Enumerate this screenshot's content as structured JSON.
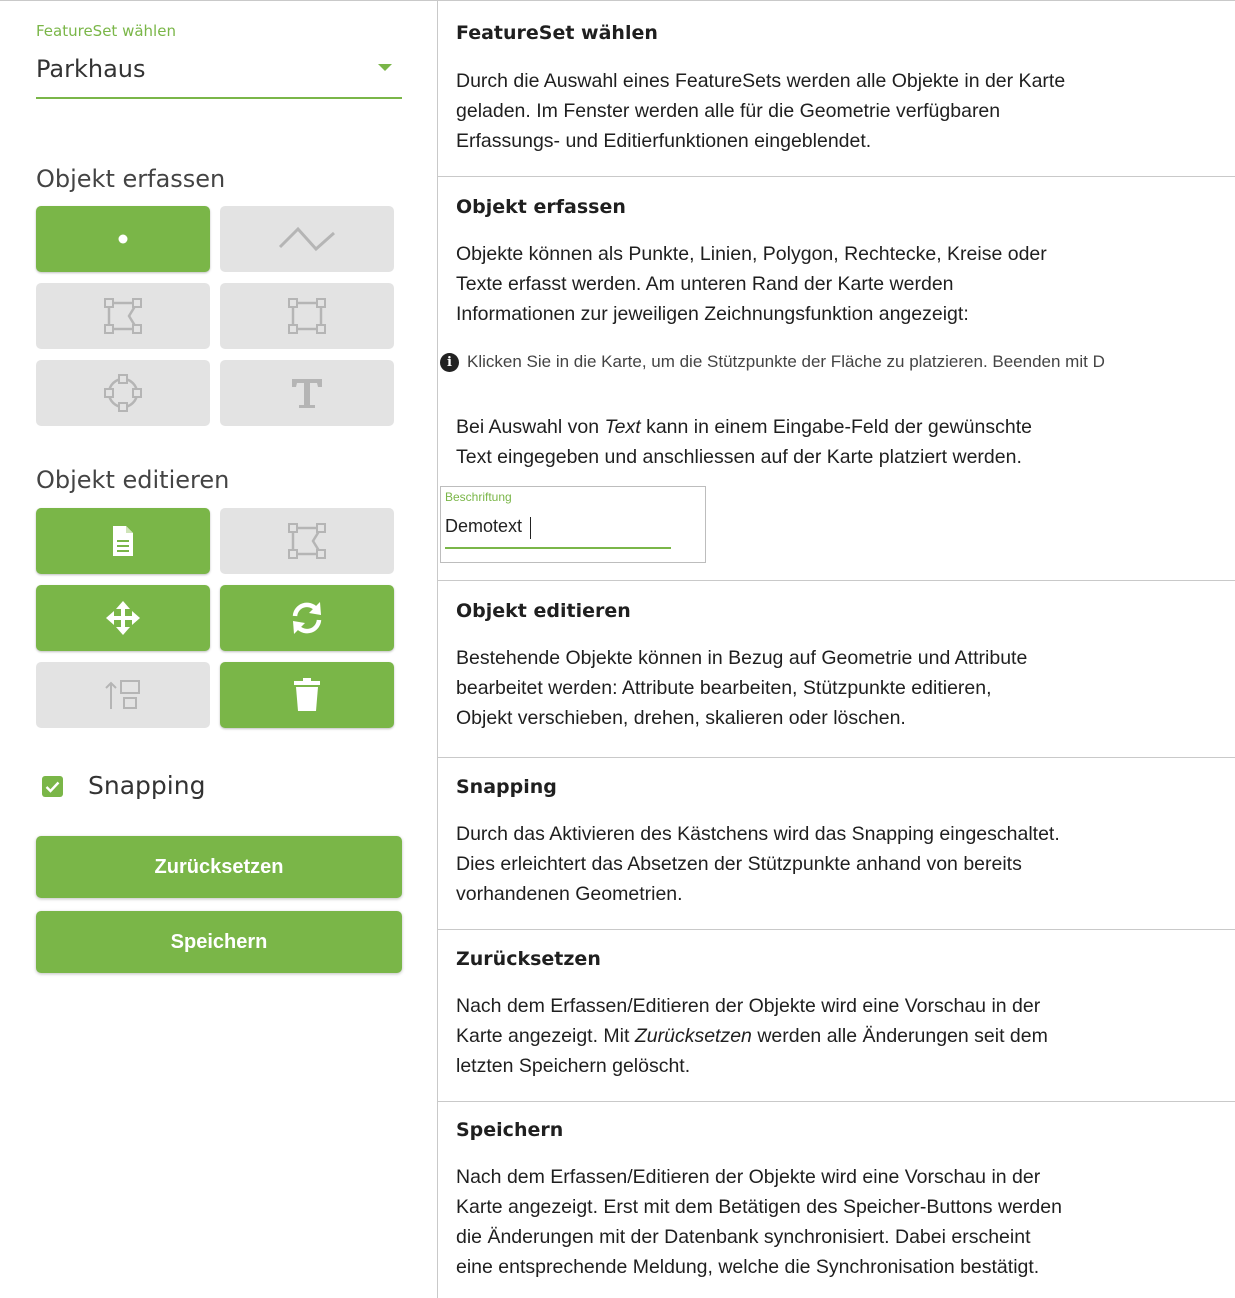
{
  "widget": {
    "featureset_label": "FeatureSet wählen",
    "featureset_value": "Parkhaus",
    "create_title": "Objekt erfassen",
    "edit_title": "Objekt editieren",
    "snapping_label": "Snapping",
    "reset_label": "Zurücksetzen",
    "save_label": "Speichern",
    "colors": {
      "accent": "#7ab648",
      "inactive": "#e3e3e3",
      "inactive_icon": "#b5b5b5"
    },
    "create_tools": [
      {
        "icon": "point-icon",
        "active": true
      },
      {
        "icon": "polyline-icon",
        "active": false
      },
      {
        "icon": "polygon-icon",
        "active": false
      },
      {
        "icon": "rectangle-icon",
        "active": false
      },
      {
        "icon": "circle-icon",
        "active": false
      },
      {
        "icon": "text-icon",
        "active": false
      }
    ],
    "edit_tools": [
      {
        "icon": "attributes-document-icon",
        "active": true
      },
      {
        "icon": "vertex-edit-icon",
        "active": false
      },
      {
        "icon": "move-icon",
        "active": true
      },
      {
        "icon": "rotate-icon",
        "active": true
      },
      {
        "icon": "scale-icon",
        "active": false
      },
      {
        "icon": "trash-icon",
        "active": true
      }
    ]
  },
  "sections": {
    "featureset": {
      "title": "FeatureSet wählen",
      "lines": [
        "Durch die Auswahl eines FeatureSets werden alle Objekte in der Karte",
        "geladen. Im Fenster werden alle für die Geometrie verfügbaren",
        "Erfassungs- und Editierfunktionen eingeblendet."
      ]
    },
    "create": {
      "title": "Objekt erfassen",
      "lines": [
        "Objekte können als Punkte, Linien, Polygon, Rechtecke, Kreise oder",
        "Texte erfasst werden. Am unteren Rand der Karte werden",
        "Informationen zur jeweiligen Zeichnungsfunktion angezeigt:"
      ],
      "hint": "Klicken Sie in die Karte, um die Stützpunkte der Fläche zu platzieren. Beenden mit D",
      "text_line1_pre": "Bei Auswahl von ",
      "text_line1_em": "Text",
      "text_line1_post": " kann in einem Eingabe-Feld der gewünschte",
      "text_line2": "Text eingegeben und anschliessen auf der Karte platziert werden.",
      "demo_label": "Beschriftung",
      "demo_value": "Demotext"
    },
    "edit": {
      "title": "Objekt editieren",
      "lines": [
        "Bestehende Objekte können in Bezug auf Geometrie und Attribute",
        "bearbeitet werden: Attribute bearbeiten, Stützpunkte editieren,",
        "Objekt verschieben, drehen, skalieren oder löschen."
      ]
    },
    "snapping": {
      "title": "Snapping",
      "lines": [
        "Durch das Aktivieren des Kästchens wird das Snapping eingeschaltet.",
        "Dies erleichtert das Absetzen der Stützpunkte anhand von bereits",
        "vorhandenen Geometrien."
      ]
    },
    "reset": {
      "title": "Zurücksetzen",
      "line1": "Nach dem Erfassen/Editieren der Objekte wird eine Vorschau in der",
      "line2_pre": "Karte angezeigt. Mit ",
      "line2_em": "Zurücksetzen",
      "line2_post": " werden alle Änderungen seit dem",
      "line3": "letzten Speichern gelöscht."
    },
    "save": {
      "title": "Speichern",
      "lines": [
        "Nach dem Erfassen/Editieren der Objekte wird eine Vorschau in der",
        "Karte angezeigt. Erst mit dem Betätigen des Speicher-Buttons werden",
        "die Änderungen mit der Datenbank synchronisiert. Dabei erscheint",
        "eine entsprechende Meldung, welche die Synchronisation bestätigt."
      ]
    }
  }
}
